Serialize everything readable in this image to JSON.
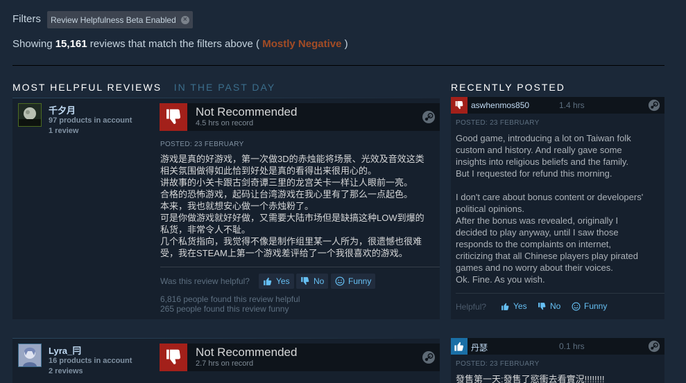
{
  "filters": {
    "label": "Filters",
    "chip": "Review Helpfulness Beta Enabled"
  },
  "summary": {
    "prefix": "Showing ",
    "count": "15,161",
    "middle": " reviews that match the filters above ( ",
    "rating": "Mostly Negative",
    "suffix": " )"
  },
  "helpful_section": {
    "title": "MOST HELPFUL REVIEWS",
    "subtitle": "IN THE PAST DAY"
  },
  "recent_section": {
    "title": "RECENTLY POSTED"
  },
  "reviews": [
    {
      "author": "千夕月",
      "products": "97 products in account",
      "reviews": "1 review",
      "verdict": "Not Recommended",
      "hours": "4.5 hrs on record",
      "posted": "POSTED: 23 FEBRUARY",
      "lines": [
        "游戏是真的好游戏，第一次做3D的赤烛能将场景、光效及音效这类",
        "相关氛围做得如此恰到好处是真的看得出来很用心的。",
        "讲故事的小关卡跟古剑奇谭三里的龙宫关卡一样让人眼前一亮。",
        "合格的恐怖游戏，起码让台湾游戏在我心里有了那么一点起色。",
        "本来，我也就想安心做一个赤烛粉了。",
        "可是你做游戏就好好做，又需要大陆市场但是缺搞这种LOW到爆的",
        "私货，非常令人不耻。",
        "几个私货指向，我觉得不像是制作组里某一人所为，很遗憾也很难",
        "受，我在STEAM上第一个游戏差评给了一个我很喜欢的游戏。"
      ],
      "helpful_question": "Was this review helpful?",
      "yes": "Yes",
      "no": "No",
      "funny": "Funny",
      "found_helpful": "6,816 people found this review helpful",
      "found_funny": "265 people found this review funny"
    },
    {
      "author": "Lyra_冃",
      "products": "16 products in account",
      "reviews": "2 reviews",
      "verdict": "Not Recommended",
      "hours": "2.7 hrs on record"
    }
  ],
  "recent": [
    {
      "author": "aswhenmos850",
      "hours": "1.4 hrs",
      "posted": "POSTED: 23 FEBRUARY",
      "lines": [
        "Good game, introducing a lot on Taiwan folk",
        "custom and history. And really gave some",
        "insights into religious beliefs and the family.",
        "But I requested for refund this morning.",
        "",
        "I don't care about bonus content or developers'",
        "political opinions.",
        "After the bonus was revealed, originally I",
        "decided to play anyway, until I saw those",
        "responds to the complaints on internet,",
        "criticizing that all Chinese players play pirated",
        "games and no worry about their voices.",
        "Ok. Fine. As you wish."
      ],
      "helpful": "Helpful?",
      "yes": "Yes",
      "no": "No",
      "funny": "Funny"
    },
    {
      "author": "丹瑟",
      "hours": "0.1 hrs",
      "posted": "POSTED: 23 FEBRUARY",
      "first_line": "發售第一天:發售了慾衝去看實況!!!!!!!!"
    }
  ]
}
